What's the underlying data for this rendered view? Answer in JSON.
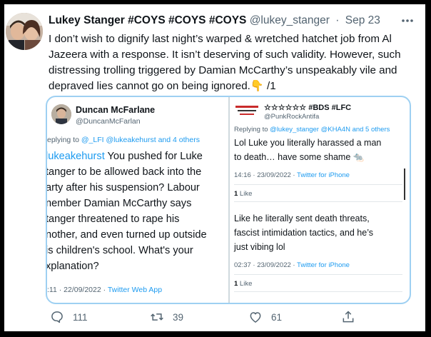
{
  "tweet": {
    "author_name": "Lukey Stanger #COYS #COYS #COYS",
    "handle": "@lukey_stanger",
    "separator": "·",
    "date": "Sep 23",
    "text_line1": "I don’t wish to dignify last night’s warped & wretched hatchet job from Al",
    "text_line2": "Jazeera with a response. It isn’t deserving of such validity. However, such",
    "text_line3": "distressing trolling triggered by Damian McCarthy’s unspeakably vile and",
    "text_line4": "depraved lies cannot go on being ignored.👇 /1"
  },
  "left_shot": {
    "name": "Duncan McFarlane",
    "handle": "@DuncanMcFarlan",
    "replying_prefix": "eplying to ",
    "replying_link": "@_LFI @lukeakehurst and 4 others",
    "line1_mention": "lukeakehurst",
    "line1_rest": " You pushed for Luke",
    "line2": "tanger to be allowed back into the",
    "line3": "arty after his suspension? Labour",
    "line4": "nember Damian McCarthy says",
    "line5": "tanger threatened to rape his",
    "line6": "nother, and even turned up outside",
    "line7": "is children's school. What's your",
    "line8": "xplanation?",
    "meta_time": ":11 · 22/09/2022 · ",
    "meta_source": "Twitter Web App"
  },
  "right_shot": {
    "name": "☆☆☆☆☆☆ #BDS #LFC",
    "handle": "@PunkRockAntifa",
    "replying_prefix": "Replying to ",
    "replying_link": "@lukey_stanger @KHA4N and 5 others",
    "body1_line1": "Lol Luke you literally harassed a man",
    "body1_line2": "to death… have some shame 🐀",
    "meta1_time": "14:16 · 23/09/2022 · ",
    "meta1_source": "Twitter for iPhone",
    "like1_count": "1",
    "like1_label": " Like",
    "body2_line1": "Like he literally sent death threats,",
    "body2_line2": "fascist intimidation tactics, and he’s",
    "body2_line3": "just vibing lol",
    "meta2_time": "02:37 · 23/09/2022 · ",
    "meta2_source": "Twitter for iPhone",
    "like2_count": "1",
    "like2_label": " Like"
  },
  "actions": {
    "reply_count": "111",
    "retweet_count": "39",
    "like_count": "61"
  },
  "icons": {
    "reply": "reply-icon",
    "retweet": "retweet-icon",
    "like": "heart-icon",
    "share": "share-icon",
    "more": "more-icon"
  },
  "colors": {
    "link_blue": "#1d9bf0",
    "secondary_text": "#536471",
    "media_border": "#9ed0f2"
  }
}
